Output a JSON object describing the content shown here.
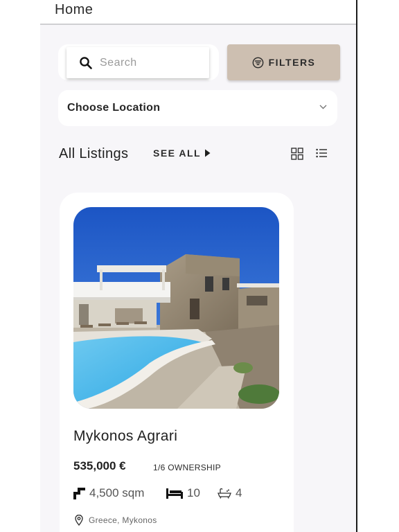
{
  "header": {
    "title": "Home"
  },
  "search": {
    "placeholder": "Search",
    "value": ""
  },
  "filters": {
    "label": "FILTERS"
  },
  "location_select": {
    "selected": "Choose Location"
  },
  "listings": {
    "title": "All Listings",
    "see_all_label": "SEE ALL",
    "items": [
      {
        "title": "Mykonos Agrari",
        "price": "535,000 €",
        "ownership": "1/6 OWNERSHIP",
        "area": "4,500 sqm",
        "bedrooms": "10",
        "bathrooms": "4",
        "location": "Greece, Mykonos"
      }
    ]
  },
  "colors": {
    "accent": "#cdbfb1",
    "background": "#f7f6f9",
    "card": "#ffffff",
    "text": "#1f1f1f"
  },
  "icons": [
    "search-icon",
    "filter-icon",
    "chevron-down-icon",
    "play-arrow-icon",
    "grid-view-icon",
    "list-view-icon",
    "area-icon",
    "bed-icon",
    "bathtub-icon",
    "location-pin-icon"
  ]
}
